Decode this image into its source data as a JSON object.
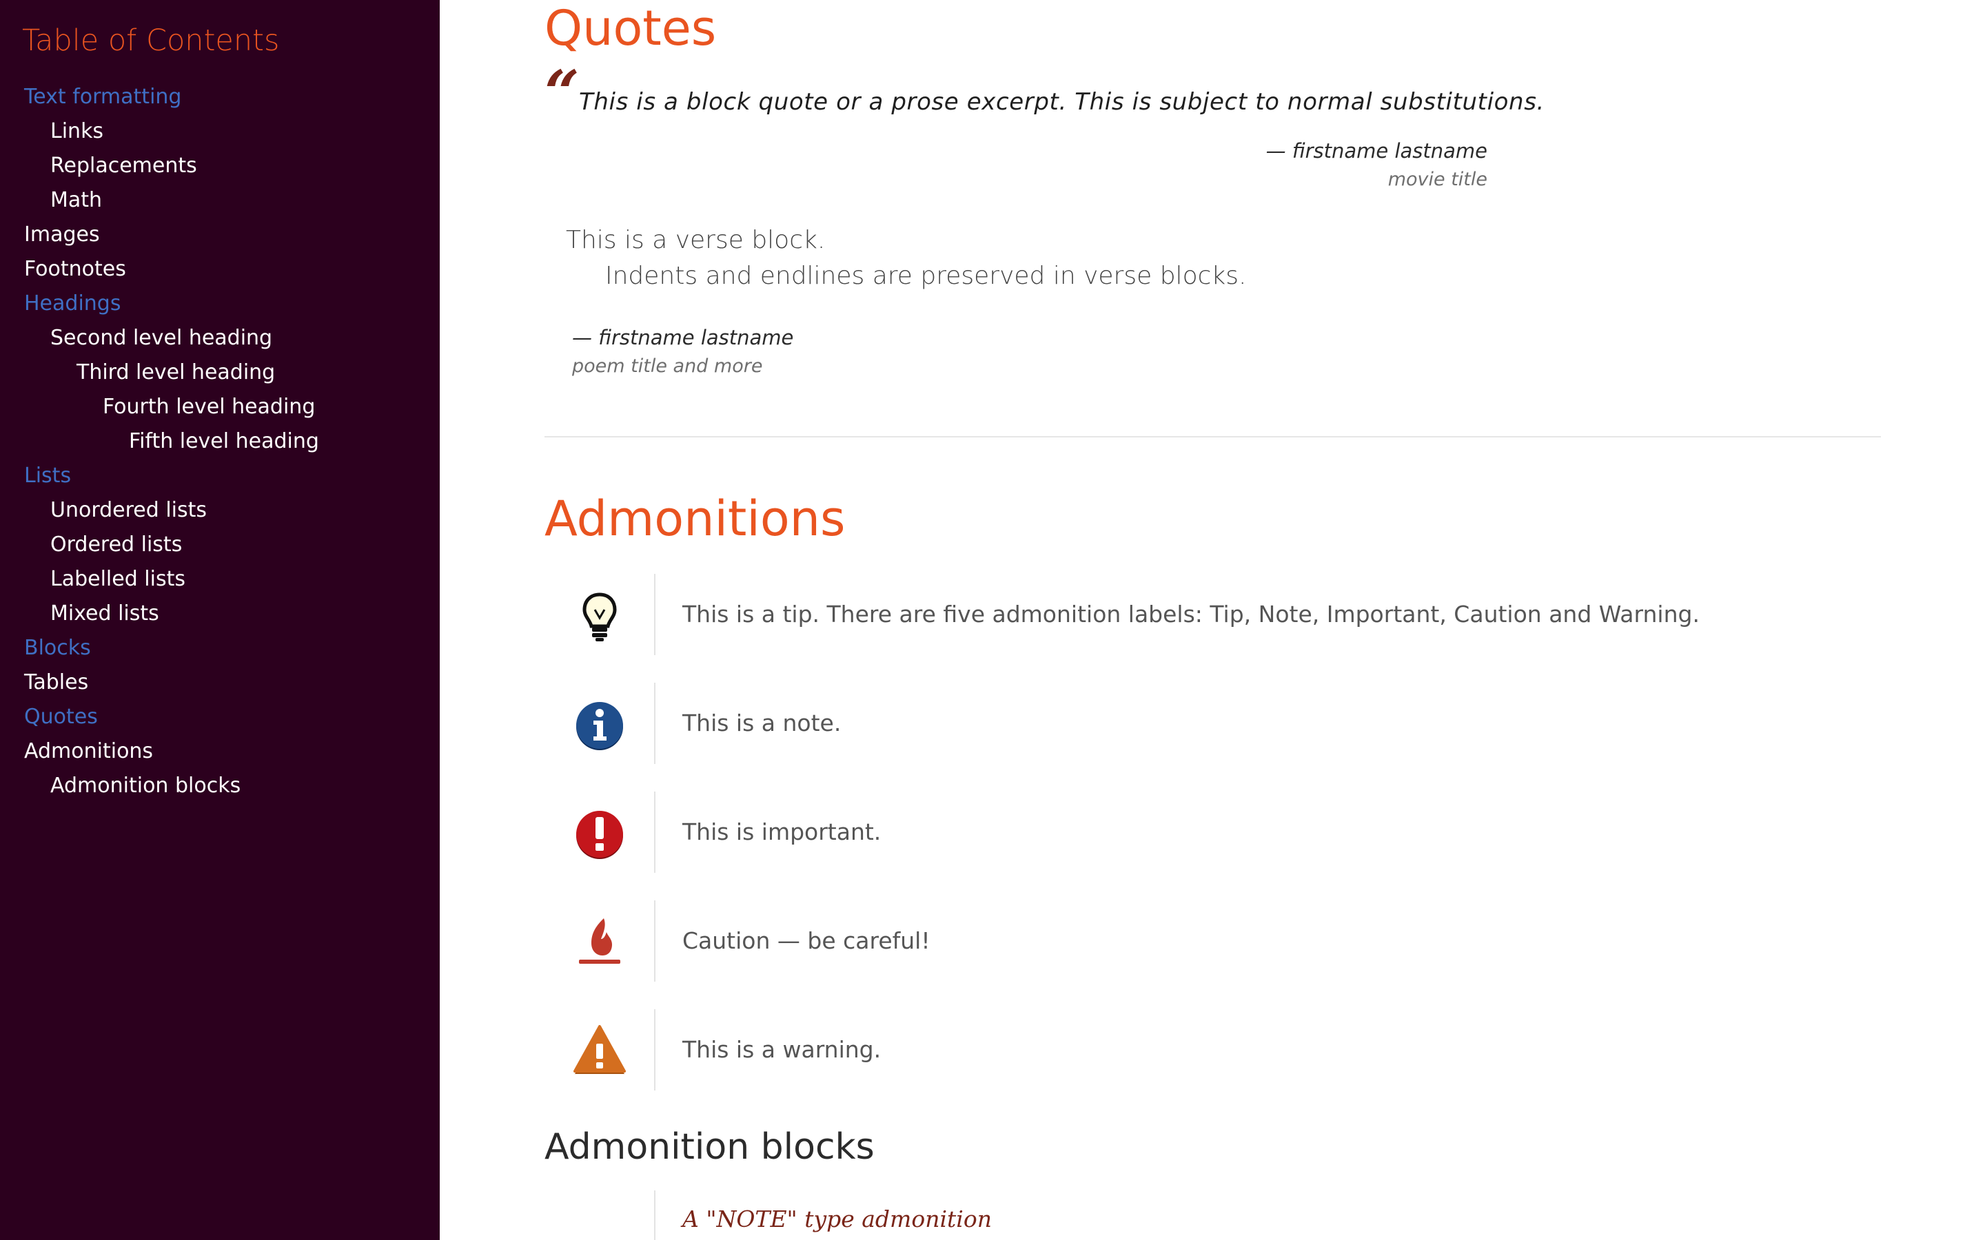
{
  "sidebar": {
    "title": "Table of Contents",
    "items": [
      {
        "label": "Text formatting",
        "level": 0,
        "active": true
      },
      {
        "label": "Links",
        "level": 1,
        "active": false
      },
      {
        "label": "Replacements",
        "level": 1,
        "active": false
      },
      {
        "label": "Math",
        "level": 1,
        "active": false
      },
      {
        "label": "Images",
        "level": 0,
        "active": false
      },
      {
        "label": "Footnotes",
        "level": 0,
        "active": false
      },
      {
        "label": "Headings",
        "level": 0,
        "active": true
      },
      {
        "label": "Second level heading",
        "level": 1,
        "active": false
      },
      {
        "label": "Third level heading",
        "level": 2,
        "active": false
      },
      {
        "label": "Fourth level heading",
        "level": 3,
        "active": false
      },
      {
        "label": "Fifth level heading",
        "level": 4,
        "active": false
      },
      {
        "label": "Lists",
        "level": 0,
        "active": true
      },
      {
        "label": "Unordered lists",
        "level": 1,
        "active": false
      },
      {
        "label": "Ordered lists",
        "level": 1,
        "active": false
      },
      {
        "label": "Labelled lists",
        "level": 1,
        "active": false
      },
      {
        "label": "Mixed lists",
        "level": 1,
        "active": false
      },
      {
        "label": "Blocks",
        "level": 0,
        "active": true
      },
      {
        "label": "Tables",
        "level": 0,
        "active": false
      },
      {
        "label": "Quotes",
        "level": 0,
        "active": true
      },
      {
        "label": "Admonitions",
        "level": 0,
        "active": false
      },
      {
        "label": "Admonition blocks",
        "level": 1,
        "active": false
      }
    ]
  },
  "quotes": {
    "heading": "Quotes",
    "block_quote": {
      "text": "This is a block quote or a prose excerpt. This is subject to normal substitutions.",
      "attribution": "— firstname lastname",
      "citetitle": "movie title"
    },
    "verse": {
      "line1": "This is a verse block.",
      "line2": "Indents and endlines are preserved in verse blocks.",
      "attribution": "— firstname lastname",
      "citetitle": "poem title and more"
    }
  },
  "admonitions": {
    "heading": "Admonitions",
    "items": [
      {
        "type": "tip",
        "icon": "lightbulb-icon",
        "text": "This is a tip. There are five admonition labels: Tip, Note, Important, Caution and Warning."
      },
      {
        "type": "note",
        "icon": "info-icon",
        "text": "This is a note."
      },
      {
        "type": "important",
        "icon": "exclamation-icon",
        "text": "This is important."
      },
      {
        "type": "caution",
        "icon": "flame-icon",
        "text": "Caution — be careful!"
      },
      {
        "type": "warning",
        "icon": "warning-triangle-icon",
        "text": "This is a warning."
      }
    ],
    "colors": {
      "accent": "#e95420",
      "sidebar_bg": "#2c001e",
      "toc_active": "#3f6fc4",
      "note_blue": "#1f4e8c",
      "important_red": "#c4161c",
      "caution_red": "#c0392b",
      "warning_orange": "#d46e1f"
    }
  },
  "admonition_blocks": {
    "heading": "Admonition blocks",
    "first_title": "A \"NOTE\" type admonition"
  }
}
